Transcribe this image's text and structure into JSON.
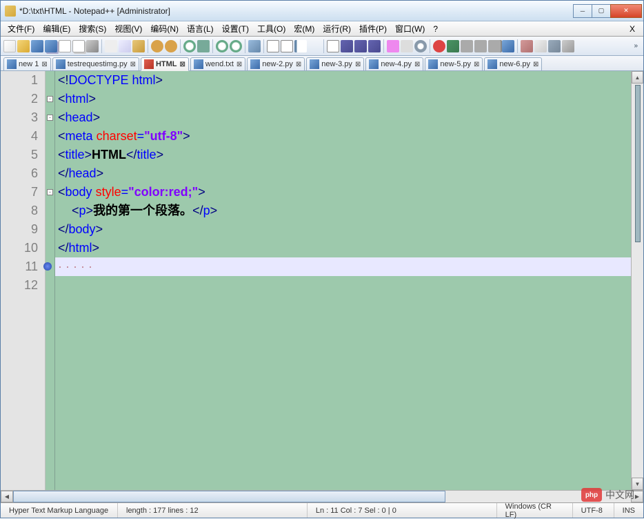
{
  "titlebar": {
    "text": "*D:\\txt\\HTML - Notepad++ [Administrator]"
  },
  "menubar": {
    "items": [
      {
        "label": "文件(F)"
      },
      {
        "label": "编辑(E)"
      },
      {
        "label": "搜索(S)"
      },
      {
        "label": "视图(V)"
      },
      {
        "label": "编码(N)"
      },
      {
        "label": "语言(L)"
      },
      {
        "label": "设置(T)"
      },
      {
        "label": "工具(O)"
      },
      {
        "label": "宏(M)"
      },
      {
        "label": "运行(R)"
      },
      {
        "label": "插件(P)"
      },
      {
        "label": "窗口(W)"
      },
      {
        "label": "?"
      }
    ],
    "close_x": "X"
  },
  "tabs": [
    {
      "label": "new 1",
      "saved": true,
      "active": false
    },
    {
      "label": "testrequestimg.py",
      "saved": true,
      "active": false
    },
    {
      "label": "HTML",
      "saved": false,
      "active": true
    },
    {
      "label": "wend.txt",
      "saved": true,
      "active": false
    },
    {
      "label": "new-2.py",
      "saved": true,
      "active": false
    },
    {
      "label": "new-3.py",
      "saved": true,
      "active": false
    },
    {
      "label": "new-4.py",
      "saved": true,
      "active": false
    },
    {
      "label": "new-5.py",
      "saved": true,
      "active": false
    },
    {
      "label": "new-6.py",
      "saved": true,
      "active": false
    }
  ],
  "code": {
    "lines": [
      {
        "n": 1,
        "html": "<span class='brk'>&lt;!</span><span class='tag'>DOCTYPE html</span><span class='brk'>&gt;</span>"
      },
      {
        "n": 2,
        "fold": "open",
        "html": "<span class='brk'>&lt;</span><span class='tag'>html</span><span class='brk'>&gt;</span>"
      },
      {
        "n": 3,
        "fold": "open",
        "html": "<span class='brk'>&lt;</span><span class='tag'>head</span><span class='brk'>&gt;</span>"
      },
      {
        "n": 4,
        "html": "<span class='brk'>&lt;</span><span class='tag'>meta</span> <span class='attr'>charset</span><span class='tag'>=</span><span class='str'>\"utf-8\"</span><span class='brk'>&gt;</span>"
      },
      {
        "n": 5,
        "html": "<span class='brk'>&lt;</span><span class='tag'>title</span><span class='brk'>&gt;</span><span class='txt'>HTML</span><span class='brk'>&lt;/</span><span class='tag'>title</span><span class='brk'>&gt;</span>"
      },
      {
        "n": 6,
        "html": "<span class='brk'>&lt;/</span><span class='tag'>head</span><span class='brk'>&gt;</span>"
      },
      {
        "n": 7,
        "fold": "open",
        "html": "<span class='brk'>&lt;</span><span class='tag'>body</span> <span class='attr'>style</span><span class='tag'>=</span><span class='str'>\"color:red;\"</span><span class='brk'>&gt;</span>"
      },
      {
        "n": 8,
        "html": "    <span class='brk'>&lt;</span><span class='tag'>p</span><span class='brk'>&gt;</span><span class='txt'>我的第一个段落。</span><span class='brk'>&lt;/</span><span class='tag'>p</span><span class='brk'>&gt;</span>"
      },
      {
        "n": 9,
        "html": "<span class='brk'>&lt;/</span><span class='tag'>body</span><span class='brk'>&gt;</span>"
      },
      {
        "n": 10,
        "html": "<span class='brk'>&lt;/</span><span class='tag'>html</span><span class='brk'>&gt;</span>"
      },
      {
        "n": 11,
        "current": true,
        "marked": true,
        "html": "<span class='ws'>· · · · ·</span>"
      },
      {
        "n": 12,
        "html": ""
      }
    ]
  },
  "statusbar": {
    "lang": "Hyper Text Markup Language",
    "length": "length : 177    lines : 12",
    "pos": "Ln : 11    Col : 7    Sel : 0 | 0",
    "eol": "Windows (CR LF)",
    "enc": "UTF-8",
    "ins": "INS"
  },
  "watermark": {
    "badge": "php",
    "text": "中文网"
  }
}
